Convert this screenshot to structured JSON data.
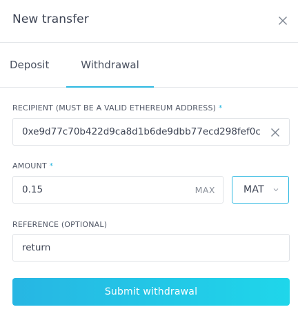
{
  "modal": {
    "title": "New transfer"
  },
  "tabs": [
    {
      "label": "Deposit",
      "active": false
    },
    {
      "label": "Withdrawal",
      "active": true
    }
  ],
  "form": {
    "recipient": {
      "label": "RECIPIENT (MUST BE A VALID ETHEREUM ADDRESS)",
      "required_mark": "*",
      "value": "0xe9d77c70b422d9ca8d1b6de9dbb77ecd298fef0c"
    },
    "amount": {
      "label": "AMOUNT",
      "required_mark": "*",
      "value": "0.15",
      "max_label": "MAX"
    },
    "currency": {
      "selected": "MAT"
    },
    "reference": {
      "label": "REFERENCE (OPTIONAL)",
      "value": "return"
    },
    "submit_label": "Submit withdrawal"
  },
  "colors": {
    "accent": "#2db8e1",
    "accent_gradient_end": "#1fd6ea",
    "border": "#dfe2e6",
    "text": "#3b4252"
  },
  "icons": {
    "close": "close-icon",
    "clear": "clear-icon",
    "chevron": "chevron-down-icon"
  }
}
